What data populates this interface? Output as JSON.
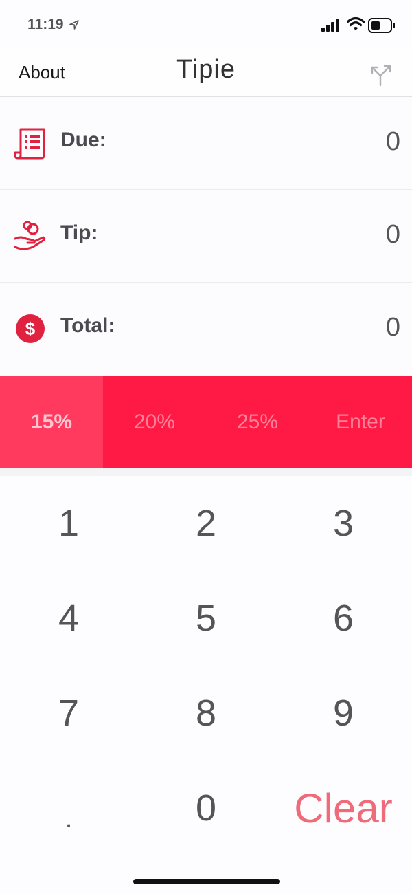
{
  "status_bar": {
    "time": "11:19"
  },
  "nav": {
    "about_label": "About",
    "title": "Tipie",
    "share_icon": "share-fork-icon"
  },
  "rows": [
    {
      "label": "Due:",
      "value": "0",
      "icon": "receipt-icon"
    },
    {
      "label": "Tip:",
      "value": "0",
      "icon": "hand-coin-icon"
    },
    {
      "label": "Total:",
      "value": "0",
      "icon": "dollar-coin-icon"
    }
  ],
  "tip_options": [
    {
      "label": "15%",
      "selected": true
    },
    {
      "label": "20%",
      "selected": false
    },
    {
      "label": "25%",
      "selected": false
    },
    {
      "label": "Enter",
      "selected": false
    }
  ],
  "keypad": [
    "1",
    "2",
    "3",
    "4",
    "5",
    "6",
    "7",
    "8",
    "9",
    ".",
    "0",
    "Clear"
  ],
  "colors": {
    "accent": "#ff1a45",
    "accent_selected": "#ff3a5e",
    "clear_text": "#f06b79",
    "icon": "#e0213f"
  }
}
